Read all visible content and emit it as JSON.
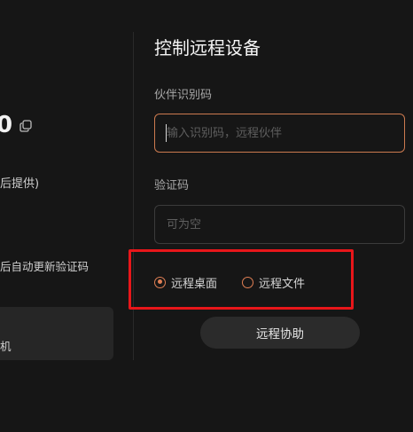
{
  "left": {
    "id_fragment": "0",
    "provider_note": "后提供)",
    "auto_update_text": "后自动更新验证码",
    "device_card_label": "机"
  },
  "right": {
    "title": "控制远程设备",
    "partner_label": "伙伴识别码",
    "partner_placeholder": "输入识别码，远程伙伴",
    "code_label": "验证码",
    "code_placeholder": "可为空",
    "options": [
      {
        "label": "远程桌面",
        "selected": true
      },
      {
        "label": "远程文件",
        "selected": false
      }
    ],
    "assist_button": "远程协助"
  },
  "colors": {
    "background": "#161616",
    "accent": "#e07f54",
    "highlight": "#e8161a"
  },
  "icons": [
    "copy-icon"
  ]
}
